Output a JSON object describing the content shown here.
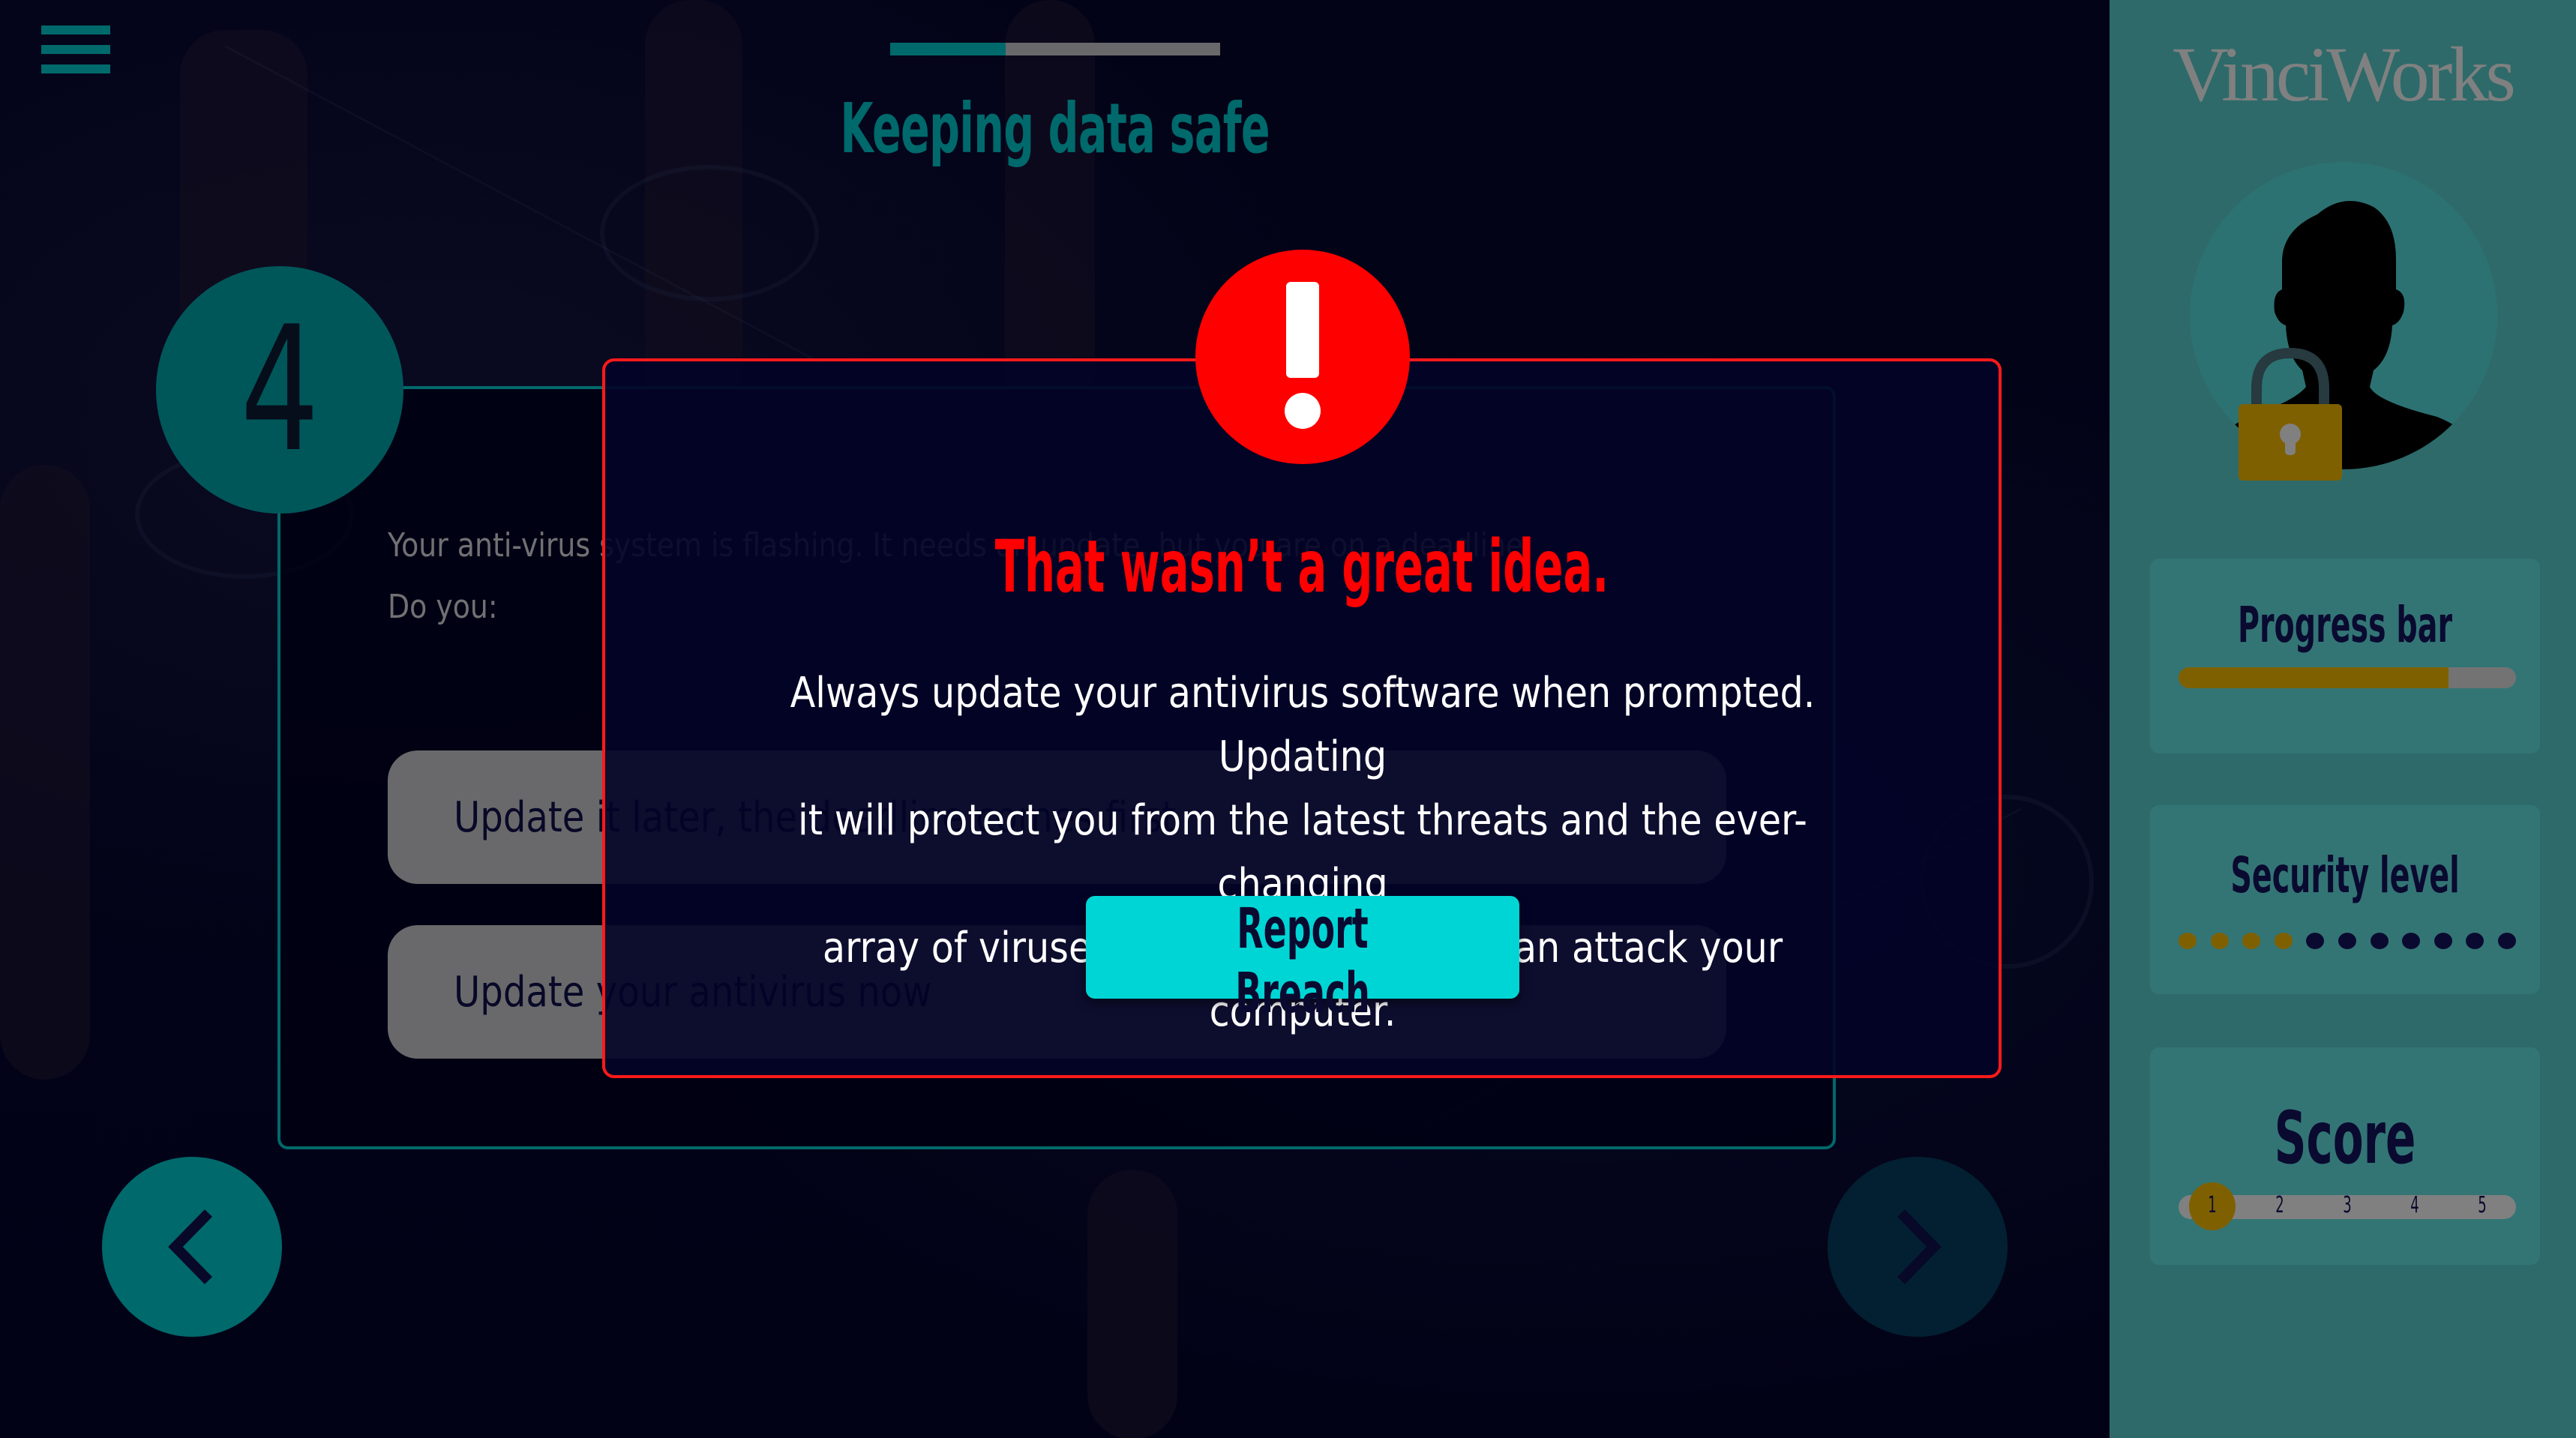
{
  "header": {
    "menu_icon": "hamburger-menu-icon",
    "title": "Keeping data safe",
    "lesson_progress_fraction": 0.35
  },
  "question": {
    "step_number": "4",
    "text_line1": "Your anti-virus system is flashing. It needs an update, but you are on a deadline.",
    "text_line2": "Do you:",
    "answers": [
      {
        "label": "Update it later, the deadline comes first"
      },
      {
        "label": "Update your antivirus now"
      }
    ]
  },
  "navigation": {
    "prev_icon": "chevron-left-icon",
    "next_icon": "chevron-right-icon"
  },
  "feedback_modal": {
    "icon": "exclamation-icon",
    "title": "That wasn’t a great idea.",
    "body_line1": "Always update your antivirus software when prompted. Updating",
    "body_line2": "it will protect you from the latest threats and the ever-changing",
    "body_line3": "array of viruses and malware which can attack your computer.",
    "button_label": "Report Breach"
  },
  "sidebar": {
    "logo": "VinciWorks",
    "avatar_icon": "user-silhouette-icon",
    "lock_icon": "padlock-icon",
    "progress": {
      "label": "Progress bar",
      "fraction": 0.8
    },
    "security": {
      "label": "Security level",
      "filled": 4,
      "total": 11
    },
    "score": {
      "label": "Score",
      "steps": [
        "1",
        "2",
        "3",
        "4",
        "5"
      ],
      "current": 1
    }
  },
  "colors": {
    "accent_teal": "#008080",
    "alert_red": "#ff0000",
    "button_cyan": "#00d5d5",
    "gold": "#7f6000",
    "sidebar_bg": "#2e6a6a",
    "navy": "#0a0a30"
  }
}
